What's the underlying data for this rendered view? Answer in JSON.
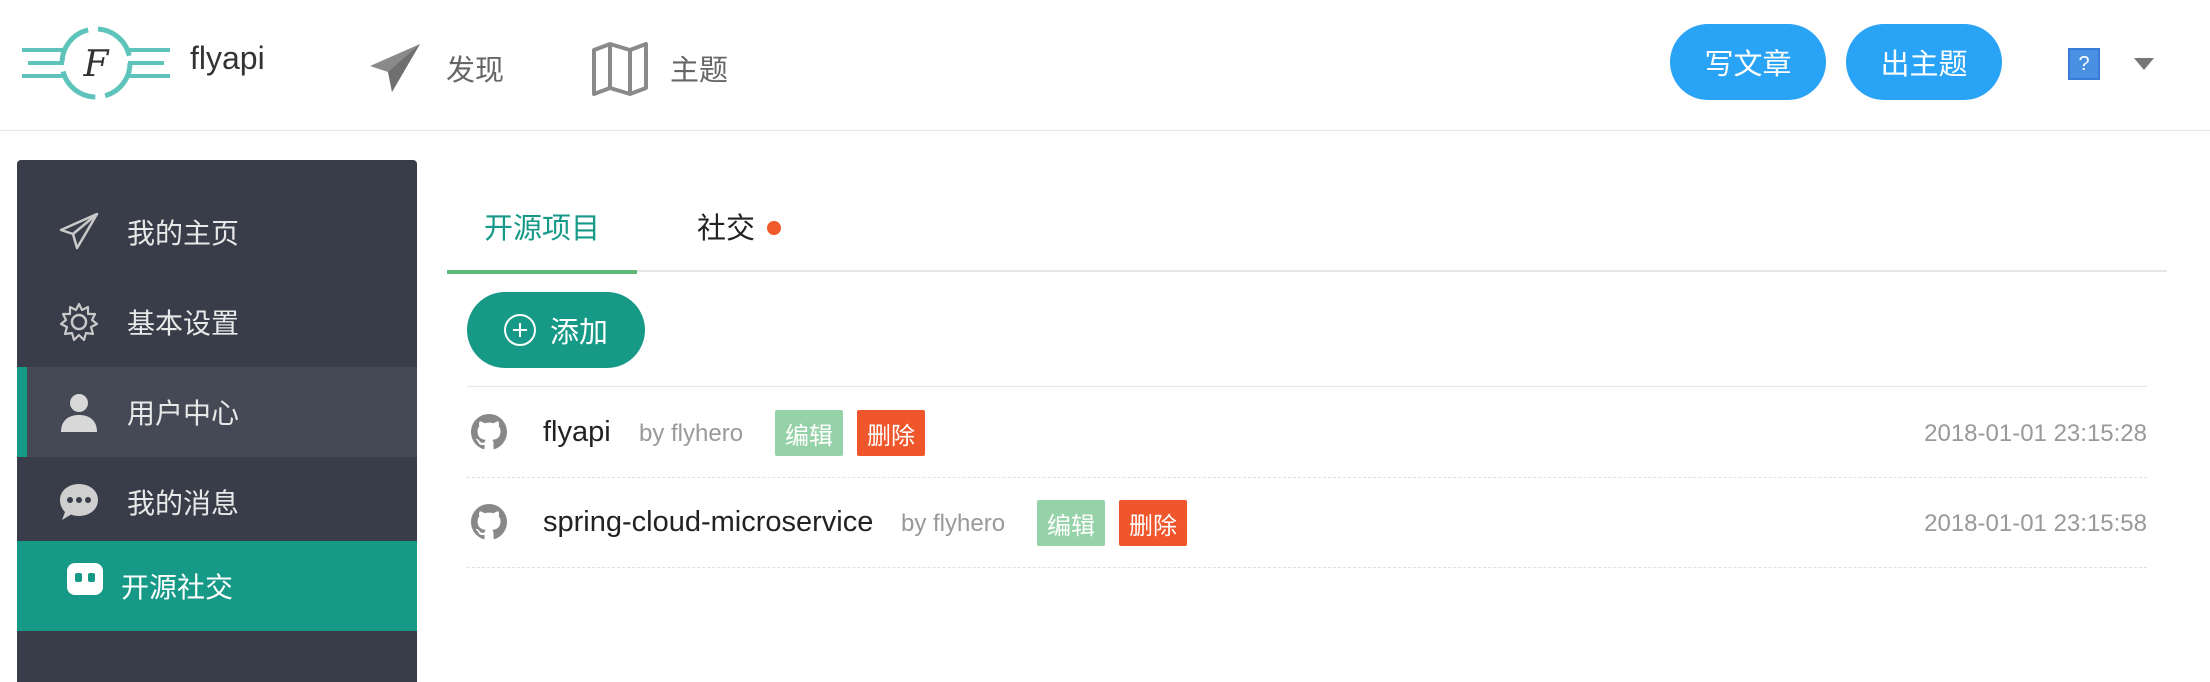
{
  "header": {
    "brand": "flyapi",
    "nav": [
      {
        "label": "发现",
        "icon": "paper-plane-icon"
      },
      {
        "label": "主题",
        "icon": "map-icon"
      }
    ],
    "write_button": "写文章",
    "topic_button": "出主题",
    "avatar_glyph": "?"
  },
  "sidebar": {
    "items": [
      {
        "label": "我的主页",
        "icon": "paper-plane-icon"
      },
      {
        "label": "基本设置",
        "icon": "gear-icon"
      },
      {
        "label": "用户中心",
        "icon": "user-icon"
      },
      {
        "label": "我的消息",
        "icon": "chat-bubble-icon"
      },
      {
        "label": "开源社交",
        "icon": "robot-face-icon"
      }
    ]
  },
  "main": {
    "tabs": [
      {
        "label": "开源项目"
      },
      {
        "label": "社交",
        "has_dot": true
      }
    ],
    "add_button": "添加",
    "projects": [
      {
        "name": "flyapi",
        "by": "by flyhero",
        "edit": "编辑",
        "delete": "删除",
        "time": "2018-01-01 23:15:28"
      },
      {
        "name": "spring-cloud-microservice",
        "by": "by flyhero",
        "edit": "编辑",
        "delete": "删除",
        "time": "2018-01-01 23:15:58"
      }
    ]
  },
  "colors": {
    "accent_teal": "#169a87",
    "primary_blue": "#29a3f5",
    "sidebar_bg": "#393d49",
    "edit_green": "#95d2a7",
    "delete_red": "#f0562c",
    "tab_underline": "#5fb878"
  }
}
